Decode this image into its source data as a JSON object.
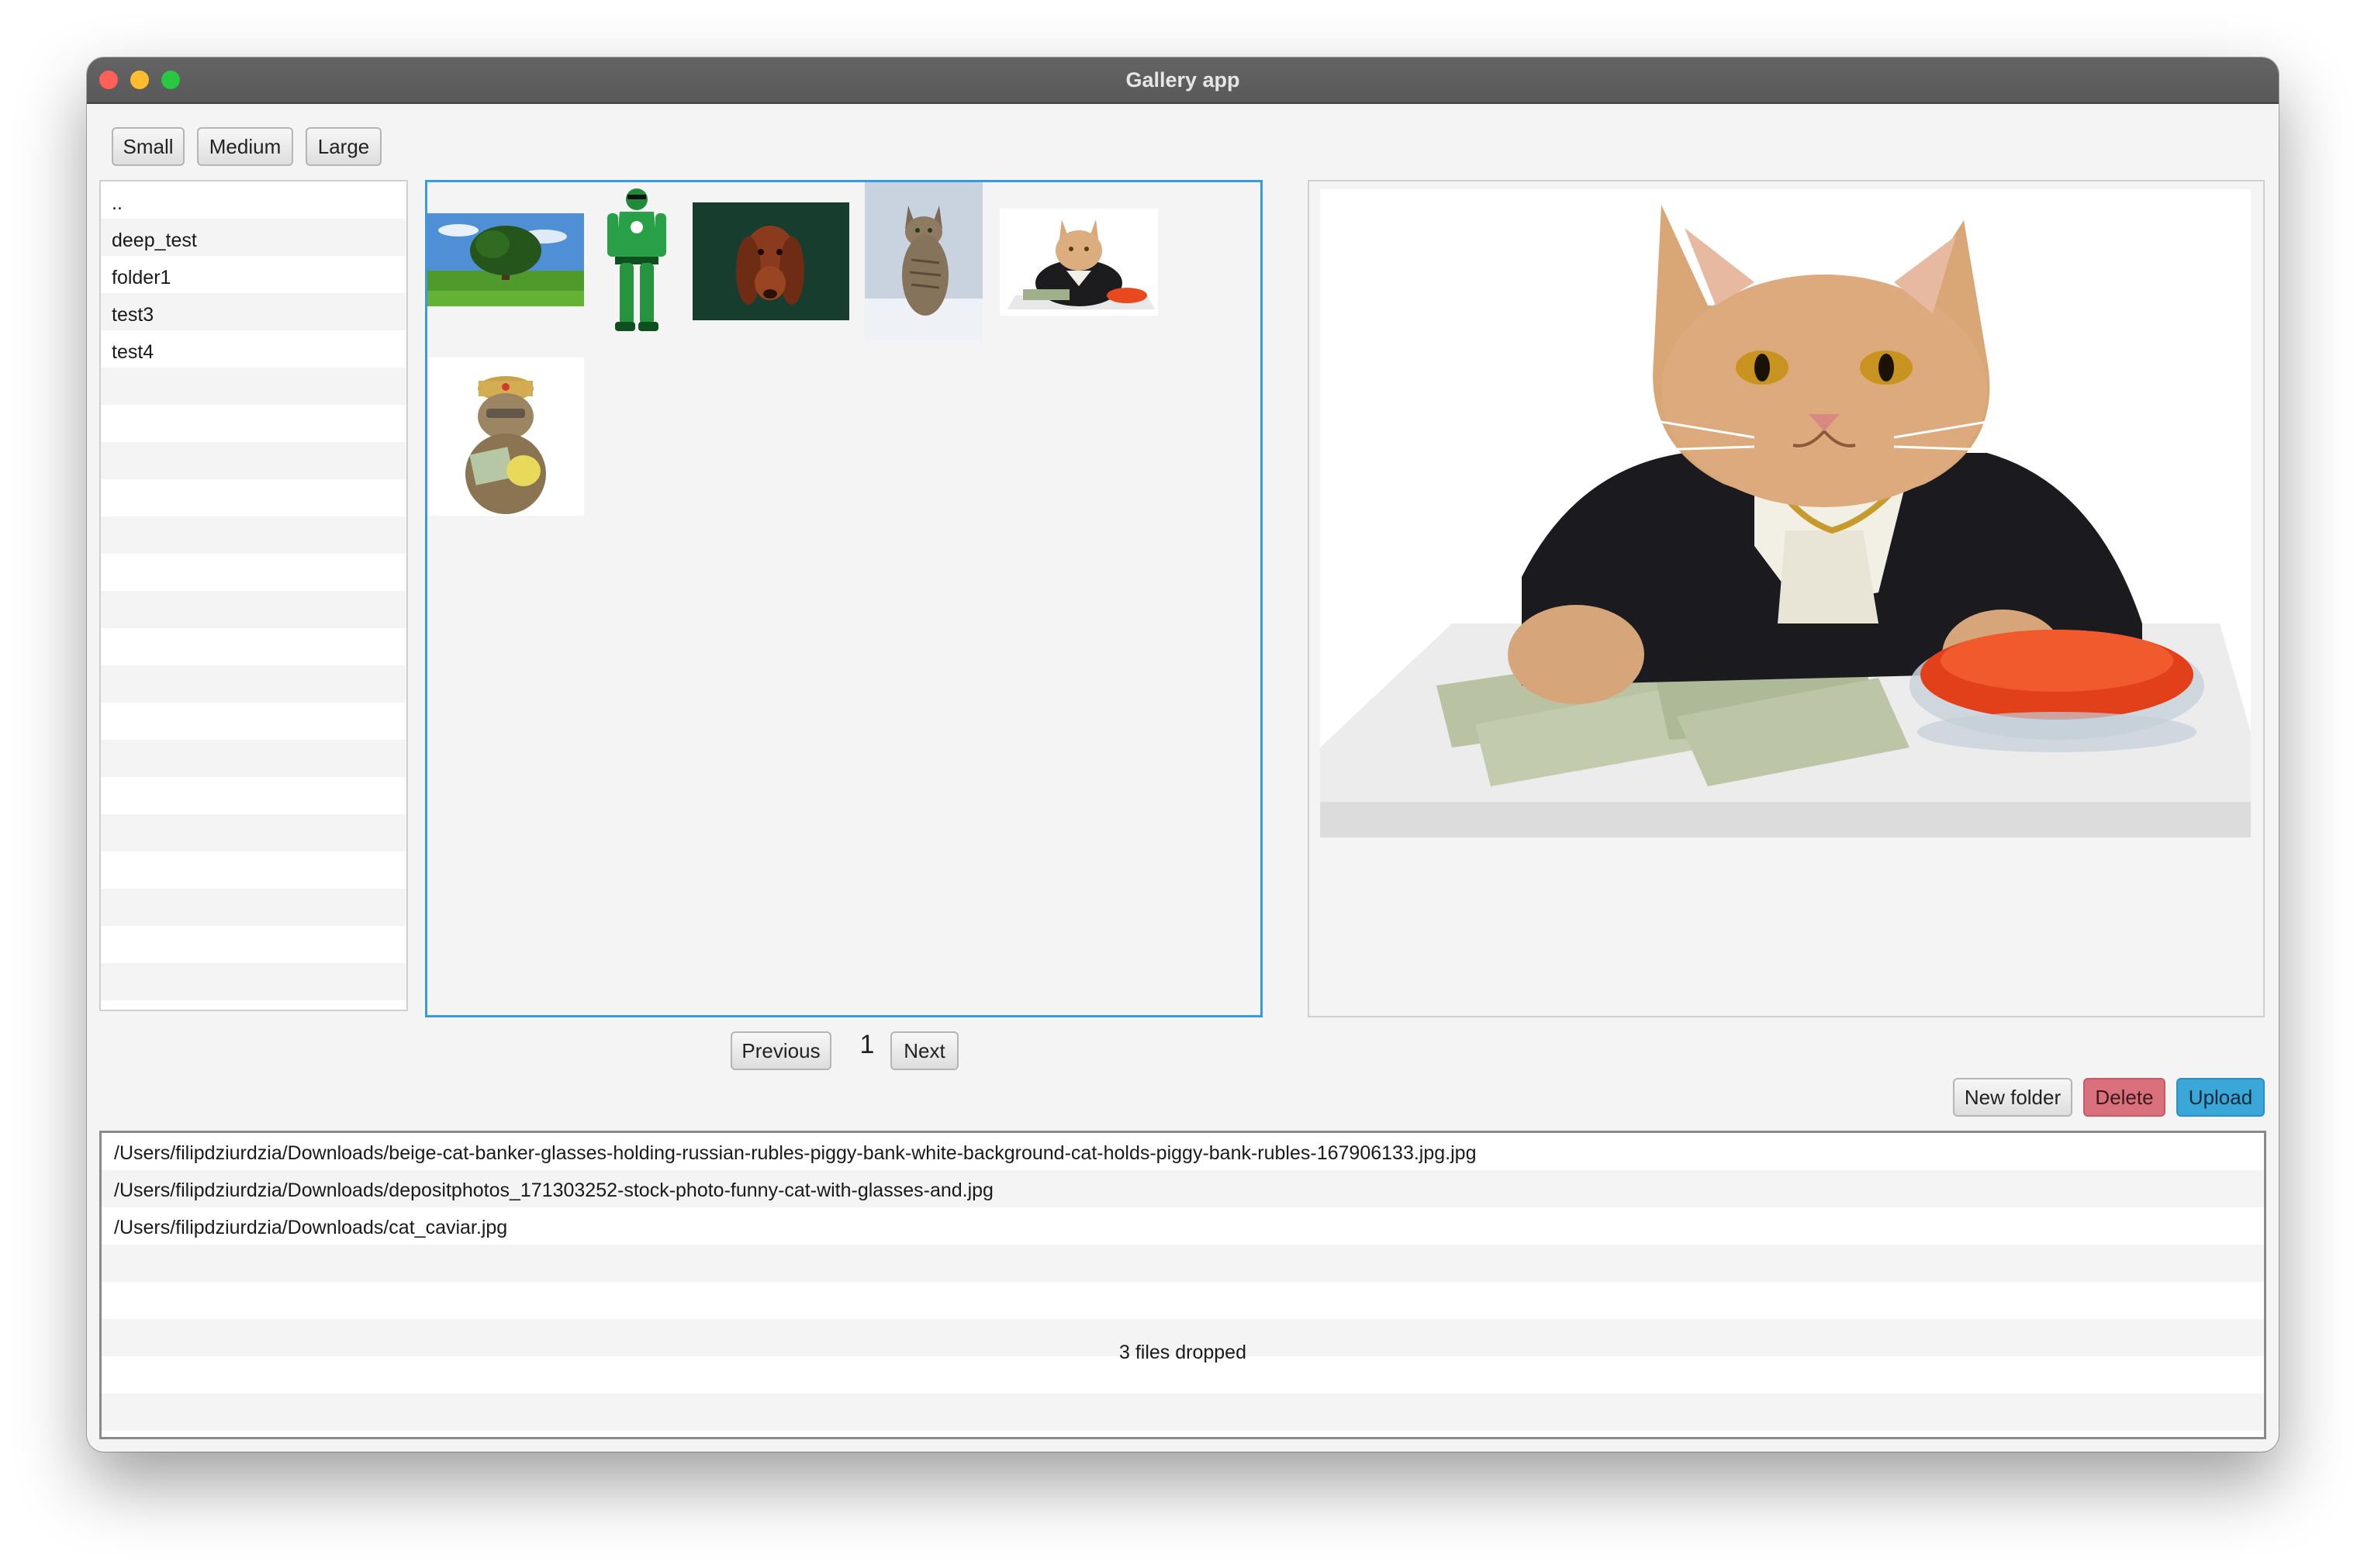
{
  "window": {
    "title": "Gallery app"
  },
  "size_buttons": {
    "small": "Small",
    "medium": "Medium",
    "large": "Large"
  },
  "folders": [
    {
      "label": ".."
    },
    {
      "label": "deep_test"
    },
    {
      "label": "folder1"
    },
    {
      "label": "test3"
    },
    {
      "label": "test4"
    }
  ],
  "thumbnails": [
    {
      "icon": "tree-landscape-image"
    },
    {
      "icon": "green-superhero-image"
    },
    {
      "icon": "red-dog-image"
    },
    {
      "icon": "tabby-cat-snow-image"
    },
    {
      "icon": "banker-cat-caviar-image"
    },
    {
      "icon": "cat-with-money-image"
    }
  ],
  "pagination": {
    "previous": "Previous",
    "page": "1",
    "next": "Next"
  },
  "preview": {
    "icon": "banker-cat-caviar-image"
  },
  "actions": {
    "new_folder": "New folder",
    "delete": "Delete",
    "upload": "Upload"
  },
  "dropped_files": [
    "/Users/filipdziurdzia/Downloads/beige-cat-banker-glasses-holding-russian-rubles-piggy-bank-white-background-cat-holds-piggy-bank-rubles-167906133.jpg.jpg",
    "/Users/filipdziurdzia/Downloads/depositphotos_171303252-stock-photo-funny-cat-with-glasses-and.jpg",
    "/Users/filipdziurdzia/Downloads/cat_caviar.jpg"
  ],
  "drop_status": "3 files dropped",
  "colors": {
    "accent": "#3a9ad9",
    "delete": "#d9707c",
    "upload": "#3ba7d9"
  }
}
